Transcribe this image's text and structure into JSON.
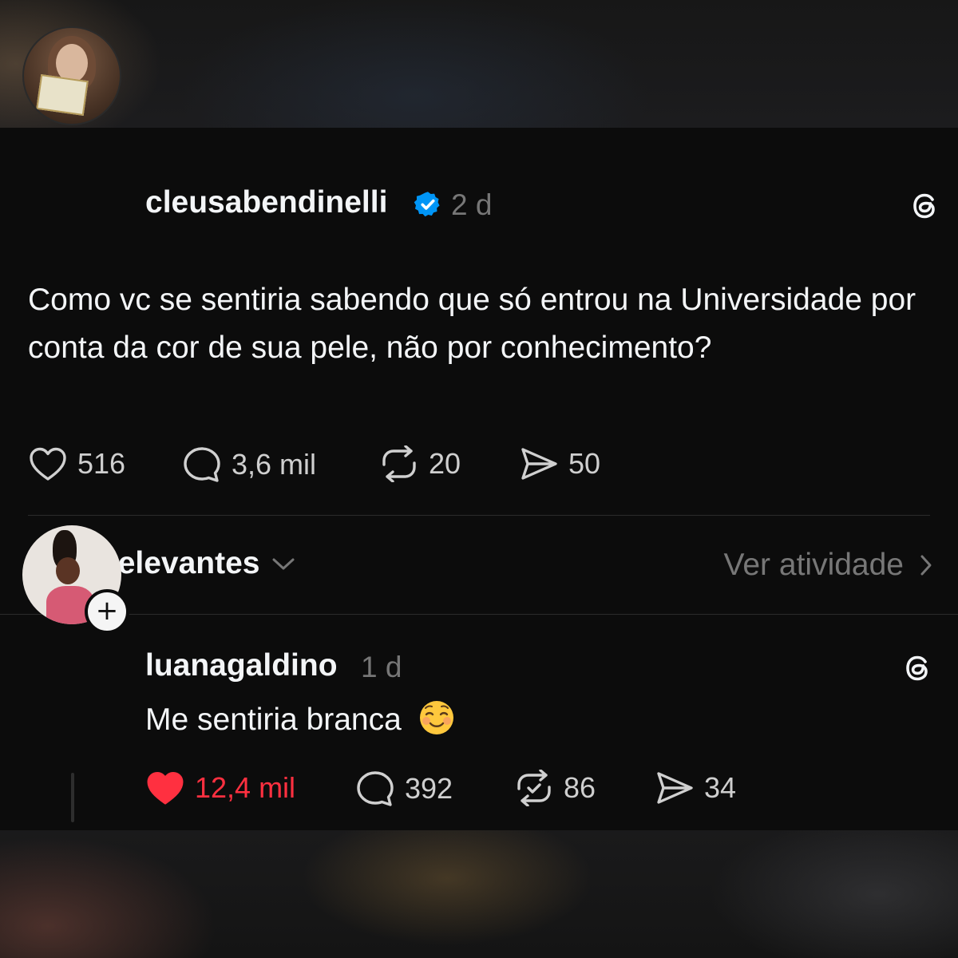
{
  "post": {
    "username": "cleusabendinelli",
    "verified": true,
    "time": "2 d",
    "text": "Como vc se sentiria sabendo que só entrou na Universidade por conta da cor de sua pele, não por conhecimento?",
    "actions": {
      "likes": "516",
      "comments": "3,6 mil",
      "reposts": "20",
      "shares": "50"
    }
  },
  "sort_bar": {
    "sort_label": "Mais relevantes",
    "activity_label": "Ver atividade"
  },
  "reply": {
    "username": "luanagaldino",
    "time": "1 d",
    "text": "Me sentiria branca",
    "emoji": "smiling-face-emoji",
    "liked": true,
    "actions": {
      "likes": "12,4 mil",
      "comments": "392",
      "reposts": "86",
      "shares": "34"
    }
  },
  "colors": {
    "background": "#0c0c0c",
    "text": "#f3f5f7",
    "muted": "#777777",
    "like_red": "#ff3040",
    "verified_blue": "#0095f6"
  }
}
